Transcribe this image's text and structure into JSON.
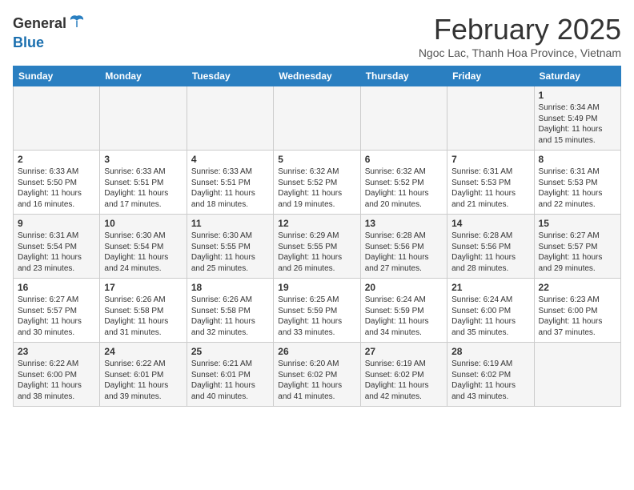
{
  "header": {
    "logo_general": "General",
    "logo_blue": "Blue",
    "month_year": "February 2025",
    "location": "Ngoc Lac, Thanh Hoa Province, Vietnam"
  },
  "weekdays": [
    "Sunday",
    "Monday",
    "Tuesday",
    "Wednesday",
    "Thursday",
    "Friday",
    "Saturday"
  ],
  "weeks": [
    [
      {
        "day": "",
        "info": ""
      },
      {
        "day": "",
        "info": ""
      },
      {
        "day": "",
        "info": ""
      },
      {
        "day": "",
        "info": ""
      },
      {
        "day": "",
        "info": ""
      },
      {
        "day": "",
        "info": ""
      },
      {
        "day": "1",
        "info": "Sunrise: 6:34 AM\nSunset: 5:49 PM\nDaylight: 11 hours and 15 minutes."
      }
    ],
    [
      {
        "day": "2",
        "info": "Sunrise: 6:33 AM\nSunset: 5:50 PM\nDaylight: 11 hours and 16 minutes."
      },
      {
        "day": "3",
        "info": "Sunrise: 6:33 AM\nSunset: 5:51 PM\nDaylight: 11 hours and 17 minutes."
      },
      {
        "day": "4",
        "info": "Sunrise: 6:33 AM\nSunset: 5:51 PM\nDaylight: 11 hours and 18 minutes."
      },
      {
        "day": "5",
        "info": "Sunrise: 6:32 AM\nSunset: 5:52 PM\nDaylight: 11 hours and 19 minutes."
      },
      {
        "day": "6",
        "info": "Sunrise: 6:32 AM\nSunset: 5:52 PM\nDaylight: 11 hours and 20 minutes."
      },
      {
        "day": "7",
        "info": "Sunrise: 6:31 AM\nSunset: 5:53 PM\nDaylight: 11 hours and 21 minutes."
      },
      {
        "day": "8",
        "info": "Sunrise: 6:31 AM\nSunset: 5:53 PM\nDaylight: 11 hours and 22 minutes."
      }
    ],
    [
      {
        "day": "9",
        "info": "Sunrise: 6:31 AM\nSunset: 5:54 PM\nDaylight: 11 hours and 23 minutes."
      },
      {
        "day": "10",
        "info": "Sunrise: 6:30 AM\nSunset: 5:54 PM\nDaylight: 11 hours and 24 minutes."
      },
      {
        "day": "11",
        "info": "Sunrise: 6:30 AM\nSunset: 5:55 PM\nDaylight: 11 hours and 25 minutes."
      },
      {
        "day": "12",
        "info": "Sunrise: 6:29 AM\nSunset: 5:55 PM\nDaylight: 11 hours and 26 minutes."
      },
      {
        "day": "13",
        "info": "Sunrise: 6:28 AM\nSunset: 5:56 PM\nDaylight: 11 hours and 27 minutes."
      },
      {
        "day": "14",
        "info": "Sunrise: 6:28 AM\nSunset: 5:56 PM\nDaylight: 11 hours and 28 minutes."
      },
      {
        "day": "15",
        "info": "Sunrise: 6:27 AM\nSunset: 5:57 PM\nDaylight: 11 hours and 29 minutes."
      }
    ],
    [
      {
        "day": "16",
        "info": "Sunrise: 6:27 AM\nSunset: 5:57 PM\nDaylight: 11 hours and 30 minutes."
      },
      {
        "day": "17",
        "info": "Sunrise: 6:26 AM\nSunset: 5:58 PM\nDaylight: 11 hours and 31 minutes."
      },
      {
        "day": "18",
        "info": "Sunrise: 6:26 AM\nSunset: 5:58 PM\nDaylight: 11 hours and 32 minutes."
      },
      {
        "day": "19",
        "info": "Sunrise: 6:25 AM\nSunset: 5:59 PM\nDaylight: 11 hours and 33 minutes."
      },
      {
        "day": "20",
        "info": "Sunrise: 6:24 AM\nSunset: 5:59 PM\nDaylight: 11 hours and 34 minutes."
      },
      {
        "day": "21",
        "info": "Sunrise: 6:24 AM\nSunset: 6:00 PM\nDaylight: 11 hours and 35 minutes."
      },
      {
        "day": "22",
        "info": "Sunrise: 6:23 AM\nSunset: 6:00 PM\nDaylight: 11 hours and 37 minutes."
      }
    ],
    [
      {
        "day": "23",
        "info": "Sunrise: 6:22 AM\nSunset: 6:00 PM\nDaylight: 11 hours and 38 minutes."
      },
      {
        "day": "24",
        "info": "Sunrise: 6:22 AM\nSunset: 6:01 PM\nDaylight: 11 hours and 39 minutes."
      },
      {
        "day": "25",
        "info": "Sunrise: 6:21 AM\nSunset: 6:01 PM\nDaylight: 11 hours and 40 minutes."
      },
      {
        "day": "26",
        "info": "Sunrise: 6:20 AM\nSunset: 6:02 PM\nDaylight: 11 hours and 41 minutes."
      },
      {
        "day": "27",
        "info": "Sunrise: 6:19 AM\nSunset: 6:02 PM\nDaylight: 11 hours and 42 minutes."
      },
      {
        "day": "28",
        "info": "Sunrise: 6:19 AM\nSunset: 6:02 PM\nDaylight: 11 hours and 43 minutes."
      },
      {
        "day": "",
        "info": ""
      }
    ]
  ]
}
